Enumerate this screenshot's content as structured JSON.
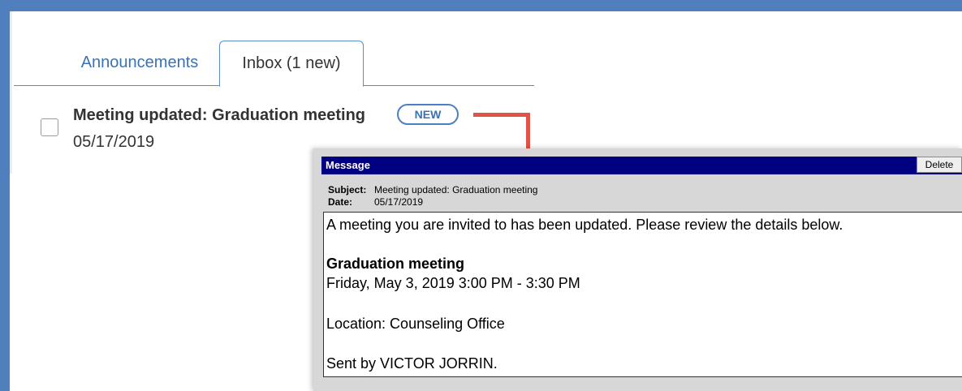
{
  "tabs": [
    {
      "label": "Announcements",
      "active": false
    },
    {
      "label": "Inbox (1 new)",
      "active": true
    }
  ],
  "message": {
    "subject": "Meeting updated: Graduation meeting",
    "badge": "NEW",
    "date": "05/17/2019"
  },
  "popup": {
    "title": "Message",
    "delete_label": "Delete",
    "subject_key": "Subject:",
    "subject_value": "Meeting updated: Graduation meeting",
    "date_key": "Date:",
    "date_value": "05/17/2019",
    "body": {
      "intro": "A meeting you are invited to has been updated. Please review the details below.",
      "event_title": "Graduation meeting",
      "event_time": "Friday, May 3, 2019 3:00 PM - 3:30 PM",
      "location": "Location: Counseling Office",
      "sent_by": "Sent by VICTOR JORRIN."
    }
  },
  "colors": {
    "frame": "#4f7fbd",
    "tab_text": "#3a72b5",
    "arrow": "#e05347",
    "popup_header": "#000080"
  }
}
